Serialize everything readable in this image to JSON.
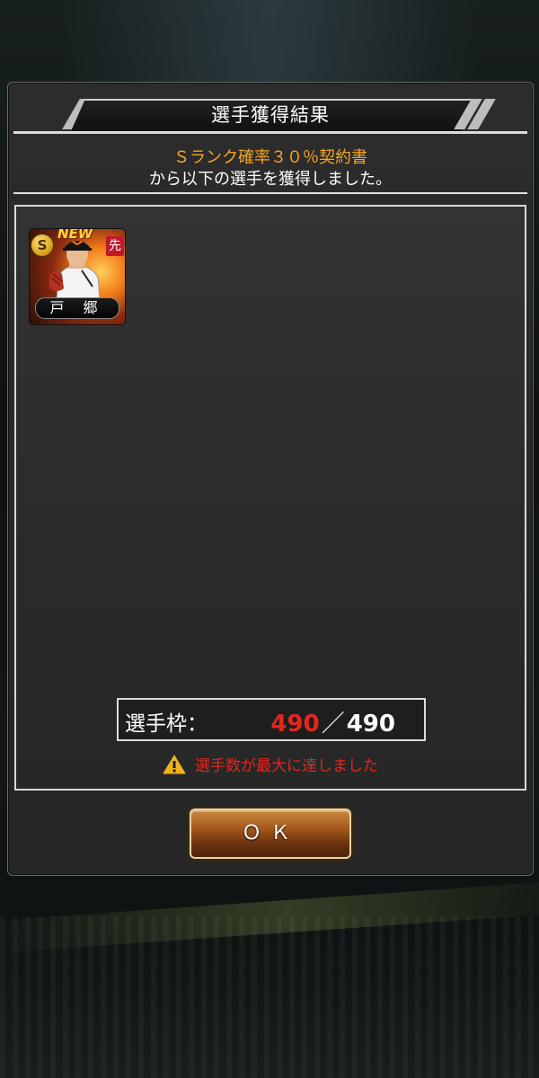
{
  "dialog": {
    "title": "選手獲得結果",
    "contract_name": "Ｓランク確率３０％契約書",
    "description": "から以下の選手を獲得しました。"
  },
  "acquired_players": [
    {
      "name": "戸 郷",
      "rank": "S",
      "new_label": "NEW",
      "position": "先"
    }
  ],
  "roster": {
    "label": "選手枠：",
    "current": "490",
    "separator": "／",
    "max": "490"
  },
  "warning_text": "選手数が最大に達しました",
  "ok_button": "ＯＫ",
  "colors": {
    "contract_name": "#f6a623",
    "warning": "#e4261e",
    "roster_current": "#e4261e"
  },
  "icons": {
    "warning": "warning-triangle-icon",
    "rank": "rank-badge-icon"
  }
}
